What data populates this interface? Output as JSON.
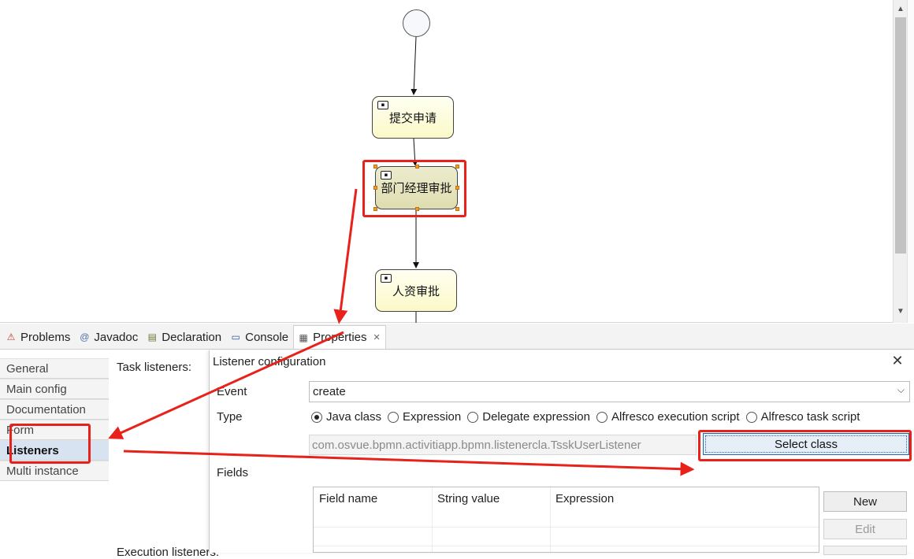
{
  "diagram": {
    "tasks": [
      {
        "label": "提交申请"
      },
      {
        "label": "部门经理审批"
      },
      {
        "label": "人资审批"
      }
    ]
  },
  "view_tabs": [
    {
      "label": "Problems",
      "icon": "problems-icon"
    },
    {
      "label": "Javadoc",
      "icon": "at-icon"
    },
    {
      "label": "Declaration",
      "icon": "declaration-icon"
    },
    {
      "label": "Console",
      "icon": "console-icon"
    },
    {
      "label": "Properties",
      "icon": "properties-icon"
    }
  ],
  "properties": {
    "side_tabs": [
      "General",
      "Main config",
      "Documentation",
      "Form",
      "Listeners",
      "Multi instance"
    ],
    "task_listeners_label": "Task listeners:",
    "execution_listeners_label": "Execution listeners:"
  },
  "listener_dialog": {
    "title": "Listener configuration",
    "event_label": "Event",
    "event_value": "create",
    "type_label": "Type",
    "type_options": [
      "Java class",
      "Expression",
      "Delegate expression",
      "Alfresco execution script",
      "Alfresco task script"
    ],
    "type_selected": "Java class",
    "class_value": "com.osvue.bpmn.activitiapp.bpmn.listenercla.TsskUserListener",
    "select_class_label": "Select class",
    "fields_label": "Fields",
    "table_headers": [
      "Field name",
      "String value",
      "Expression"
    ],
    "buttons": {
      "new": "New",
      "edit": "Edit"
    }
  },
  "colors": {
    "annotation_red": "#e8211a",
    "selected_tab_bg": "#d7e3f0",
    "task_fill": "#fbf9c8"
  }
}
